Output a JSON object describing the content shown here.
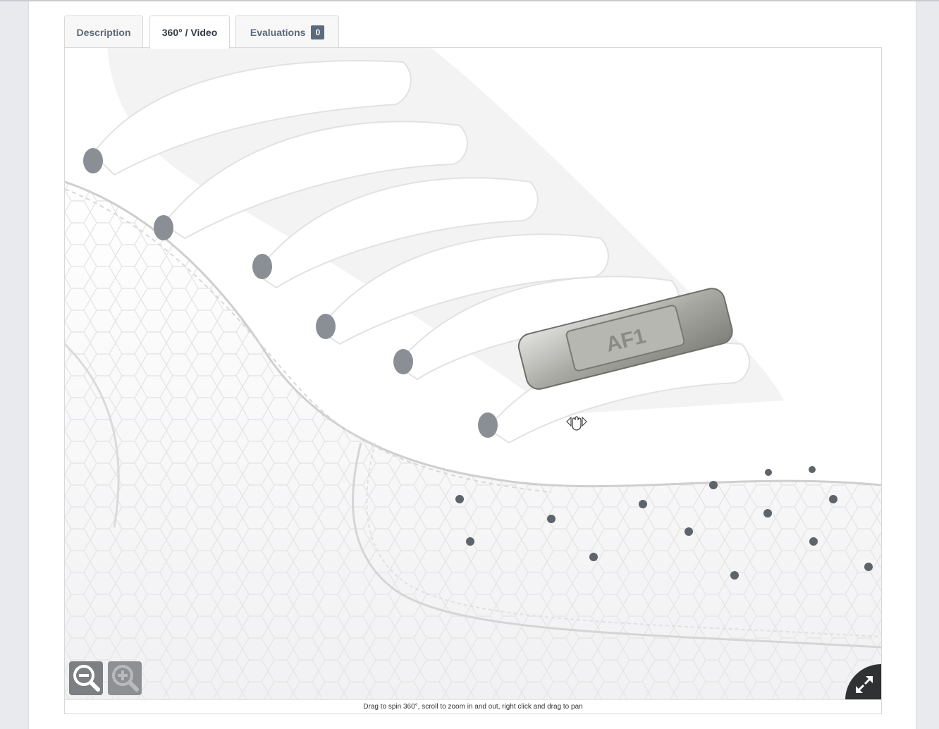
{
  "tabs": {
    "description": "Description",
    "video": "360° / Video",
    "evaluations": "Evaluations",
    "evaluations_count": "0"
  },
  "viewer": {
    "caption": "Drag to spin 360°, scroll to zoom in and out, right click and drag to pan",
    "product_badge_text": "AF1",
    "active_tab": "360° / Video"
  },
  "icons": {
    "zoom_out": "magnifier-minus-icon",
    "zoom_in": "magnifier-plus-icon",
    "fullscreen": "expand-arrows-icon",
    "cursor": "hand-drag-cursor-icon"
  },
  "colors": {
    "page_bg": "#e9eaee",
    "badge_bg": "#5c6a7e",
    "zoom_button": "#7d7f82",
    "fullscreen_button": "#2f3133"
  }
}
